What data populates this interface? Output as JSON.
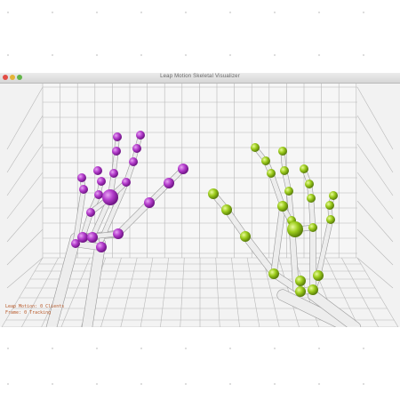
{
  "window": {
    "title": "Leap Motion Skeletal Visualizer"
  },
  "hud": {
    "line1": "Leap Motion: 0 Clients",
    "line2": "Frame: 0  Tracking"
  },
  "colors": {
    "left_hand": "#b43ccc",
    "right_hand": "#9ccc1c",
    "bones": "#ededed",
    "grid_lines": "#b8b8b8",
    "background": "#f2f2f2"
  },
  "icons": [
    "close-button",
    "minimize-button",
    "maximize-button"
  ]
}
